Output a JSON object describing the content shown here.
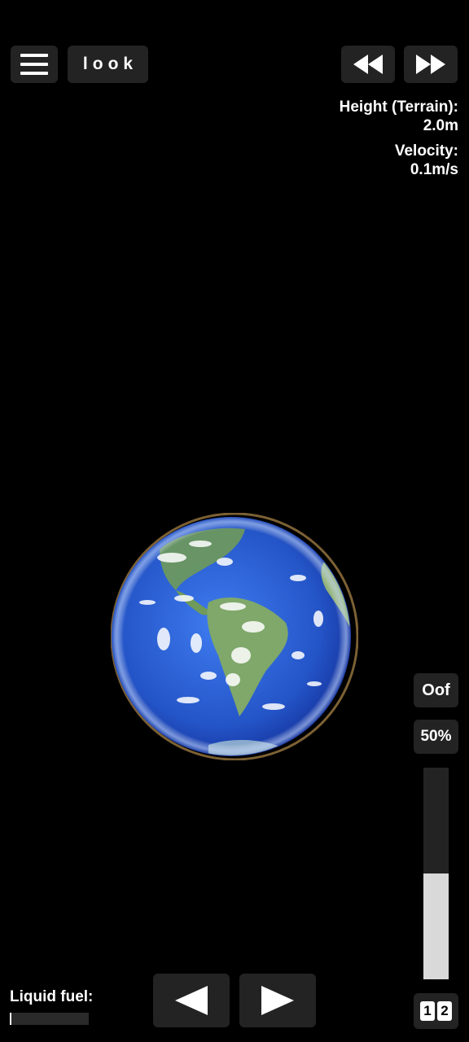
{
  "toolbar": {
    "menu_icon": "hamburger-menu-icon",
    "look_label": "look",
    "rewind_icon": "rewind-icon",
    "fast_forward_icon": "fast-forward-icon"
  },
  "telemetry": {
    "height_label": "Height (Terrain):",
    "height_value": "2.0m",
    "velocity_label": "Velocity:",
    "velocity_value": "0.1m/s"
  },
  "controls": {
    "oof_label": "Oof",
    "throttle_text": "50%",
    "throttle_fraction": 0.5,
    "stage_numbers": [
      "1",
      "2"
    ],
    "left_icon": "rotate-left-arrow-icon",
    "right_icon": "rotate-right-arrow-icon"
  },
  "fuel": {
    "label": "Liquid fuel:",
    "fraction": 0.02
  },
  "colors": {
    "background": "#000000",
    "button": "#232323",
    "ocean": "#2a5fd6",
    "land": "#6f9a5a",
    "throttle_fill": "#d9d9d9"
  }
}
